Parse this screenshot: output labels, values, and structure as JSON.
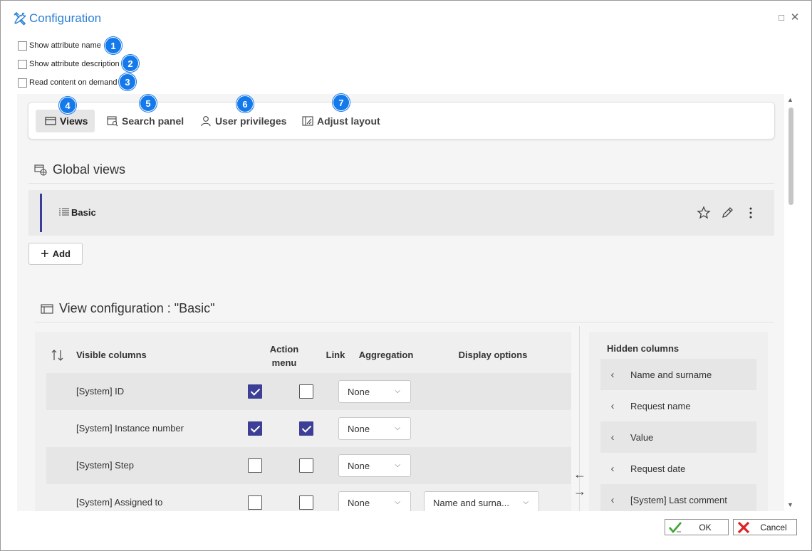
{
  "window": {
    "title": "Configuration",
    "maximize_glyph": "□",
    "close_glyph": "✕"
  },
  "options": [
    {
      "label": "Show attribute name",
      "checked": false,
      "badge": "1"
    },
    {
      "label": "Show attribute description",
      "checked": false,
      "badge": "2"
    },
    {
      "label": "Read content on demand",
      "checked": false,
      "badge": "3"
    }
  ],
  "tabs": [
    {
      "label": "Views",
      "icon": "window-icon",
      "badge": "4",
      "active": true
    },
    {
      "label": "Search panel",
      "icon": "search-panel-icon",
      "badge": "5",
      "active": false
    },
    {
      "label": "User privileges",
      "icon": "user-icon",
      "badge": "6",
      "active": false
    },
    {
      "label": "Adjust layout",
      "icon": "layout-icon",
      "badge": "7",
      "active": false
    }
  ],
  "global_views": {
    "title": "Global views",
    "items": [
      {
        "name": "Basic"
      }
    ],
    "add_label": "Add"
  },
  "view_config": {
    "title": "View configuration : \"Basic\"",
    "headers": {
      "visible_columns": "Visible columns",
      "action_menu_1": "Action",
      "action_menu_2": "menu",
      "link": "Link",
      "aggregation": "Aggregation",
      "display_options": "Display options"
    },
    "rows": [
      {
        "name": "[System] ID",
        "action_menu": true,
        "link": false,
        "aggregation": "None",
        "display": ""
      },
      {
        "name": "[System] Instance number",
        "action_menu": true,
        "link": true,
        "aggregation": "None",
        "display": ""
      },
      {
        "name": "[System] Step",
        "action_menu": false,
        "link": false,
        "aggregation": "None",
        "display": ""
      },
      {
        "name": "[System] Assigned to",
        "action_menu": false,
        "link": false,
        "aggregation": "None",
        "display": "Name and surna..."
      }
    ]
  },
  "hidden_columns": {
    "title": "Hidden columns",
    "items": [
      "Name and surname",
      "Request name",
      "Value",
      "Request date",
      "[System] Last comment"
    ]
  },
  "footer": {
    "ok_label": "OK",
    "cancel_label": "Cancel"
  },
  "colors": {
    "accent": "#2b7fd4",
    "badge": "#1479ea",
    "checkbox_checked": "#3d3e96"
  }
}
